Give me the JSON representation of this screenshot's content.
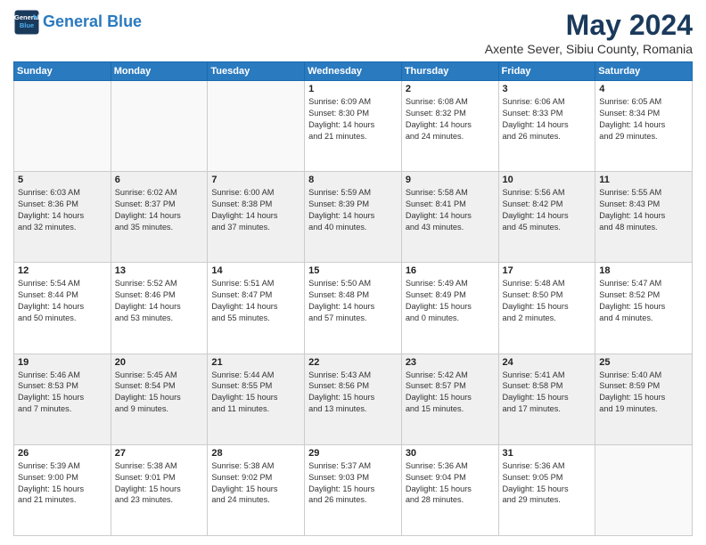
{
  "header": {
    "logo_line1": "General",
    "logo_line2": "Blue",
    "month": "May 2024",
    "location": "Axente Sever, Sibiu County, Romania"
  },
  "weekdays": [
    "Sunday",
    "Monday",
    "Tuesday",
    "Wednesday",
    "Thursday",
    "Friday",
    "Saturday"
  ],
  "weeks": [
    [
      {
        "day": "",
        "info": ""
      },
      {
        "day": "",
        "info": ""
      },
      {
        "day": "",
        "info": ""
      },
      {
        "day": "1",
        "info": "Sunrise: 6:09 AM\nSunset: 8:30 PM\nDaylight: 14 hours\nand 21 minutes."
      },
      {
        "day": "2",
        "info": "Sunrise: 6:08 AM\nSunset: 8:32 PM\nDaylight: 14 hours\nand 24 minutes."
      },
      {
        "day": "3",
        "info": "Sunrise: 6:06 AM\nSunset: 8:33 PM\nDaylight: 14 hours\nand 26 minutes."
      },
      {
        "day": "4",
        "info": "Sunrise: 6:05 AM\nSunset: 8:34 PM\nDaylight: 14 hours\nand 29 minutes."
      }
    ],
    [
      {
        "day": "5",
        "info": "Sunrise: 6:03 AM\nSunset: 8:36 PM\nDaylight: 14 hours\nand 32 minutes."
      },
      {
        "day": "6",
        "info": "Sunrise: 6:02 AM\nSunset: 8:37 PM\nDaylight: 14 hours\nand 35 minutes."
      },
      {
        "day": "7",
        "info": "Sunrise: 6:00 AM\nSunset: 8:38 PM\nDaylight: 14 hours\nand 37 minutes."
      },
      {
        "day": "8",
        "info": "Sunrise: 5:59 AM\nSunset: 8:39 PM\nDaylight: 14 hours\nand 40 minutes."
      },
      {
        "day": "9",
        "info": "Sunrise: 5:58 AM\nSunset: 8:41 PM\nDaylight: 14 hours\nand 43 minutes."
      },
      {
        "day": "10",
        "info": "Sunrise: 5:56 AM\nSunset: 8:42 PM\nDaylight: 14 hours\nand 45 minutes."
      },
      {
        "day": "11",
        "info": "Sunrise: 5:55 AM\nSunset: 8:43 PM\nDaylight: 14 hours\nand 48 minutes."
      }
    ],
    [
      {
        "day": "12",
        "info": "Sunrise: 5:54 AM\nSunset: 8:44 PM\nDaylight: 14 hours\nand 50 minutes."
      },
      {
        "day": "13",
        "info": "Sunrise: 5:52 AM\nSunset: 8:46 PM\nDaylight: 14 hours\nand 53 minutes."
      },
      {
        "day": "14",
        "info": "Sunrise: 5:51 AM\nSunset: 8:47 PM\nDaylight: 14 hours\nand 55 minutes."
      },
      {
        "day": "15",
        "info": "Sunrise: 5:50 AM\nSunset: 8:48 PM\nDaylight: 14 hours\nand 57 minutes."
      },
      {
        "day": "16",
        "info": "Sunrise: 5:49 AM\nSunset: 8:49 PM\nDaylight: 15 hours\nand 0 minutes."
      },
      {
        "day": "17",
        "info": "Sunrise: 5:48 AM\nSunset: 8:50 PM\nDaylight: 15 hours\nand 2 minutes."
      },
      {
        "day": "18",
        "info": "Sunrise: 5:47 AM\nSunset: 8:52 PM\nDaylight: 15 hours\nand 4 minutes."
      }
    ],
    [
      {
        "day": "19",
        "info": "Sunrise: 5:46 AM\nSunset: 8:53 PM\nDaylight: 15 hours\nand 7 minutes."
      },
      {
        "day": "20",
        "info": "Sunrise: 5:45 AM\nSunset: 8:54 PM\nDaylight: 15 hours\nand 9 minutes."
      },
      {
        "day": "21",
        "info": "Sunrise: 5:44 AM\nSunset: 8:55 PM\nDaylight: 15 hours\nand 11 minutes."
      },
      {
        "day": "22",
        "info": "Sunrise: 5:43 AM\nSunset: 8:56 PM\nDaylight: 15 hours\nand 13 minutes."
      },
      {
        "day": "23",
        "info": "Sunrise: 5:42 AM\nSunset: 8:57 PM\nDaylight: 15 hours\nand 15 minutes."
      },
      {
        "day": "24",
        "info": "Sunrise: 5:41 AM\nSunset: 8:58 PM\nDaylight: 15 hours\nand 17 minutes."
      },
      {
        "day": "25",
        "info": "Sunrise: 5:40 AM\nSunset: 8:59 PM\nDaylight: 15 hours\nand 19 minutes."
      }
    ],
    [
      {
        "day": "26",
        "info": "Sunrise: 5:39 AM\nSunset: 9:00 PM\nDaylight: 15 hours\nand 21 minutes."
      },
      {
        "day": "27",
        "info": "Sunrise: 5:38 AM\nSunset: 9:01 PM\nDaylight: 15 hours\nand 23 minutes."
      },
      {
        "day": "28",
        "info": "Sunrise: 5:38 AM\nSunset: 9:02 PM\nDaylight: 15 hours\nand 24 minutes."
      },
      {
        "day": "29",
        "info": "Sunrise: 5:37 AM\nSunset: 9:03 PM\nDaylight: 15 hours\nand 26 minutes."
      },
      {
        "day": "30",
        "info": "Sunrise: 5:36 AM\nSunset: 9:04 PM\nDaylight: 15 hours\nand 28 minutes."
      },
      {
        "day": "31",
        "info": "Sunrise: 5:36 AM\nSunset: 9:05 PM\nDaylight: 15 hours\nand 29 minutes."
      },
      {
        "day": "",
        "info": ""
      }
    ]
  ]
}
